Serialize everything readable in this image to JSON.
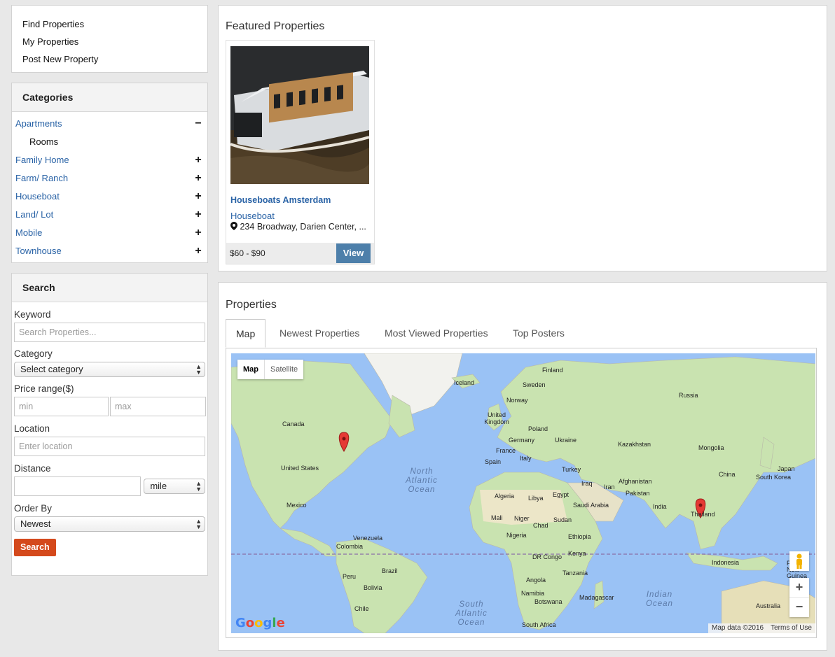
{
  "nav": {
    "links": [
      "Find Properties",
      "My Properties",
      "Post New Property"
    ]
  },
  "categories": {
    "title": "Categories",
    "items": [
      {
        "label": "Apartments",
        "toggle": "−"
      },
      {
        "label": "Rooms",
        "toggle": ""
      },
      {
        "label": "Family Home",
        "toggle": "+"
      },
      {
        "label": "Farm/ Ranch",
        "toggle": "+"
      },
      {
        "label": "Houseboat",
        "toggle": "+"
      },
      {
        "label": "Land/ Lot",
        "toggle": "+"
      },
      {
        "label": "Mobile",
        "toggle": "+"
      },
      {
        "label": "Townhouse",
        "toggle": "+"
      }
    ]
  },
  "search": {
    "title": "Search",
    "keyword_label": "Keyword",
    "keyword_placeholder": "Search Properties...",
    "category_label": "Category",
    "category_value": "Select category",
    "price_label": "Price range($)",
    "min_placeholder": "min",
    "max_placeholder": "max",
    "location_label": "Location",
    "location_placeholder": "Enter location",
    "distance_label": "Distance",
    "distance_unit": "mile",
    "order_label": "Order By",
    "order_value": "Newest",
    "button": "Search"
  },
  "featured": {
    "title": "Featured Properties",
    "card": {
      "title": "Houseboats Amsterdam",
      "type": "Houseboat",
      "address": "234 Broadway, Darien Center, ...",
      "price": "$60 - $90",
      "view": "View"
    }
  },
  "properties": {
    "title": "Properties",
    "tabs": [
      "Map",
      "Newest Properties",
      "Most Viewed Properties",
      "Top Posters"
    ],
    "map": {
      "type_map": "Map",
      "type_satellite": "Satellite",
      "attribution": "Map data ©2016",
      "terms": "Terms of Use",
      "logo": "Google",
      "zoom_in": "+",
      "zoom_out": "−",
      "labels": [
        "Finland",
        "Sweden",
        "Iceland",
        "Norway",
        "Russia",
        "United Kingdom",
        "Poland",
        "Germany",
        "Ukraine",
        "France",
        "Kazakhstan",
        "Mongolia",
        "Spain",
        "Italy",
        "Turkey",
        "China",
        "Japan",
        "South Korea",
        "Canada",
        "United States",
        "Mexico",
        "Iraq",
        "Iran",
        "Afghanistan",
        "Pakistan",
        "Algeria",
        "Libya",
        "Egypt",
        "Saudi Arabia",
        "India",
        "Thailand",
        "Mali",
        "Niger",
        "Chad",
        "Sudan",
        "Nigeria",
        "Ethiopia",
        "Venezuela",
        "Colombia",
        "DR Congo",
        "Kenya",
        "Indonesia",
        "Papua New Guinea",
        "Peru",
        "Brazil",
        "Angola",
        "Bolivia",
        "Tanzania",
        "Namibia",
        "Botswana",
        "Madagascar",
        "Chile",
        "South Africa",
        "Australia"
      ],
      "oceans": [
        "North Atlantic Ocean",
        "South Atlantic Ocean",
        "Indian Ocean"
      ]
    }
  }
}
